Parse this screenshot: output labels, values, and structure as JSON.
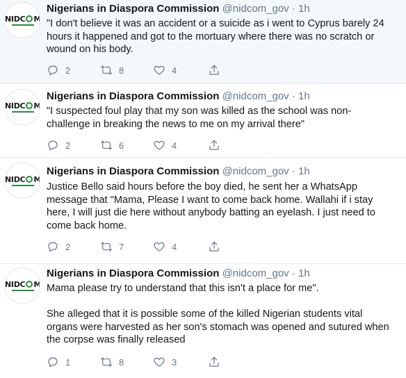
{
  "avatar_logo_text": "NIDCOM",
  "tweets": [
    {
      "name": "Nigerians in Diaspora Commission",
      "handle": "@nidcom_gov",
      "dot": "·",
      "time": "1h",
      "lines": [
        "\"I don't believe it was an accident or a suicide as i went to Cyprus barely 24",
        "hours it happened and got to the mortuary where there was no scratch or",
        "wound on his body."
      ],
      "replies": "2",
      "retweets": "8",
      "likes": "4"
    },
    {
      "name": "Nigerians in Diaspora Commission",
      "handle": "@nidcom_gov",
      "dot": "·",
      "time": "1h",
      "lines": [
        "\"I suspected foul play that my son was killed as the school was non-",
        "challenge in breaking the news to me on my arrival there\""
      ],
      "replies": "2",
      "retweets": "6",
      "likes": "4"
    },
    {
      "name": "Nigerians in Diaspora Commission",
      "handle": "@nidcom_gov",
      "dot": "·",
      "time": "1h",
      "lines": [
        "Justice Bello said hours before the boy died, he sent her a WhatsApp",
        "message that \"Mama, Please I want to come back home. Wallahi if i stay",
        "here, I will just die here without anybody batting an eyelash. I just need to",
        "come back home."
      ],
      "replies": "2",
      "retweets": "7",
      "likes": "4"
    },
    {
      "name": "Nigerians in Diaspora Commission",
      "handle": "@nidcom_gov",
      "dot": "·",
      "time": "1h",
      "lines": [
        "Mama please try to understand that this isn't a place for me\".",
        "",
        "She alleged that it is possible some of the killed Nigerian students vital",
        "organs were harvested as her son's stomach was opened and sutured when",
        "the corpse was finally released"
      ],
      "replies": "1",
      "retweets": "8",
      "likes": "3"
    }
  ]
}
